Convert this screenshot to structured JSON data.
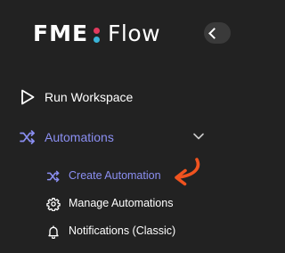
{
  "brand": {
    "name_part1": "FME",
    "name_part2": "Flow",
    "dot_top_color": "#e23a5e",
    "dot_bottom_color": "#3ab4d8"
  },
  "colors": {
    "background": "#222222",
    "accent": "#8b8ff2",
    "annotation_arrow": "#f0531f"
  },
  "nav": {
    "run_workspace": {
      "label": "Run Workspace",
      "icon": "play-outline-icon"
    },
    "automations": {
      "label": "Automations",
      "icon": "shuffle-icon",
      "expanded": true,
      "expand_icon": "chevron-down-icon",
      "subitems": [
        {
          "label": "Create Automation",
          "icon": "shuffle-icon",
          "active": true
        },
        {
          "label": "Manage Automations",
          "icon": "gear-icon",
          "active": false
        },
        {
          "label": "Notifications (Classic)",
          "icon": "bell-icon",
          "active": false
        }
      ]
    }
  },
  "collapse_toggle": {
    "icon": "chevron-left-icon"
  },
  "annotation": {
    "icon": "curved-arrow-icon"
  }
}
